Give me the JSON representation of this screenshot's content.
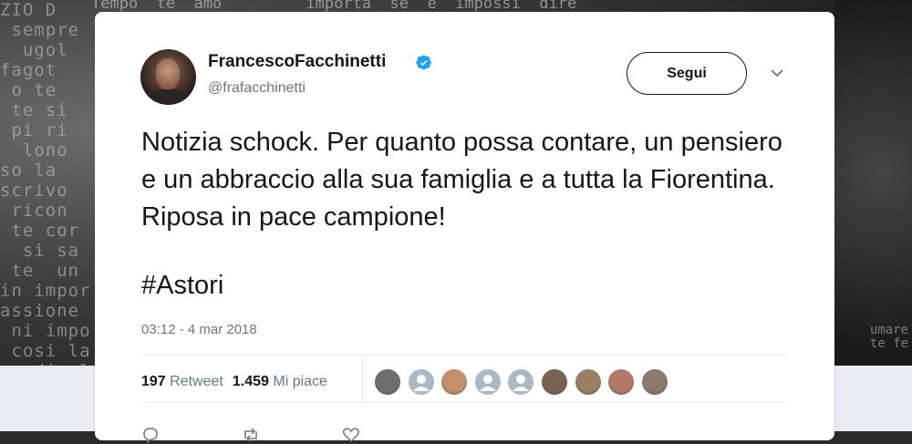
{
  "tweet": {
    "display_name": "FrancescoFacchinetti",
    "handle": "@frafacchinetti",
    "follow_label": "Segui",
    "text": "Notizia schock. Per quanto possa contare, un pensiero e un abbraccio alla sua famiglia e a tutta la Fiorentina. Riposa in pace campione!",
    "hashtag": "#Astori",
    "timestamp": "03:12 - 4 mar 2018",
    "retweet_count": "197",
    "retweet_label": "Retweet",
    "like_count": "1.459",
    "like_label": "Mi piace"
  },
  "icons": {
    "verified": "verified-badge-icon",
    "more": "chevron-down-icon",
    "reply": "reply-icon",
    "retweet": "retweet-icon",
    "like": "heart-icon"
  },
  "colors": {
    "accent": "#1da1f2",
    "text": "#14171a",
    "secondary": "#657786",
    "divider": "#e6ecf0"
  },
  "likers": [
    {
      "color": "#6e6e6e"
    },
    {
      "color": "#aab8c2"
    },
    {
      "color": "#c48f6a"
    },
    {
      "color": "#aab8c2"
    },
    {
      "color": "#aab8c2"
    },
    {
      "color": "#7a6252"
    },
    {
      "color": "#9a7f64"
    },
    {
      "color": "#b27a66"
    },
    {
      "color": "#8d7a6a"
    }
  ]
}
